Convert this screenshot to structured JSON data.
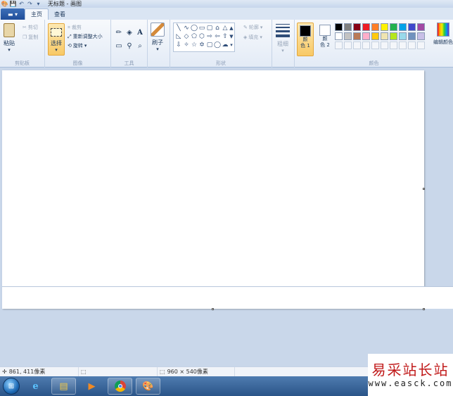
{
  "window": {
    "title": "无标题 - 画图"
  },
  "quick_access": [
    "app-icon",
    "save-icon",
    "undo-icon",
    "redo-icon",
    "customize-icon"
  ],
  "tabs": [
    {
      "label": "主页",
      "active": true
    },
    {
      "label": "查看",
      "active": false
    }
  ],
  "ribbon": {
    "clipboard": {
      "label": "剪贴板",
      "paste": "粘贴",
      "cut": "剪切",
      "copy": "复制"
    },
    "image": {
      "label": "图像",
      "select": "选择",
      "crop": "裁剪",
      "resize": "重新调整大小",
      "rotate": "旋转"
    },
    "tools": {
      "label": "工具"
    },
    "brushes": {
      "label": "刷子"
    },
    "shapes": {
      "label": "形状",
      "outline": "轮廓",
      "fill": "填充"
    },
    "size": {
      "label": "粗细"
    },
    "colors": {
      "label": "颜色",
      "color1": "颜色 1",
      "color1_line1": "颜",
      "color1_line2": "色 1",
      "color2_line1": "颜",
      "color2_line2": "色 2",
      "edit_colors": "编辑颜色",
      "color1_value": "#000000",
      "color2_value": "#ffffff",
      "palette_row1": [
        "#000000",
        "#7f7f7f",
        "#880015",
        "#ed1c24",
        "#ff7f27",
        "#fff200",
        "#22b14c",
        "#00a2e8",
        "#3f48cc",
        "#a349a4"
      ],
      "palette_row2": [
        "#ffffff",
        "#c3c3c3",
        "#b97a57",
        "#ffaec9",
        "#ffc90e",
        "#efe4b0",
        "#b5e61d",
        "#99d9ea",
        "#7092be",
        "#c8bfe7"
      ]
    }
  },
  "statusbar": {
    "cursor_pos": "861, 411像素",
    "selection_size": "",
    "canvas_size": "960 × 540像素"
  },
  "taskbar": {
    "items": [
      "start",
      "internet-explorer",
      "file-explorer",
      "media-player",
      "chrome",
      "paint"
    ]
  },
  "watermark": {
    "title": "易采站长站",
    "url": "www.easck.com"
  }
}
